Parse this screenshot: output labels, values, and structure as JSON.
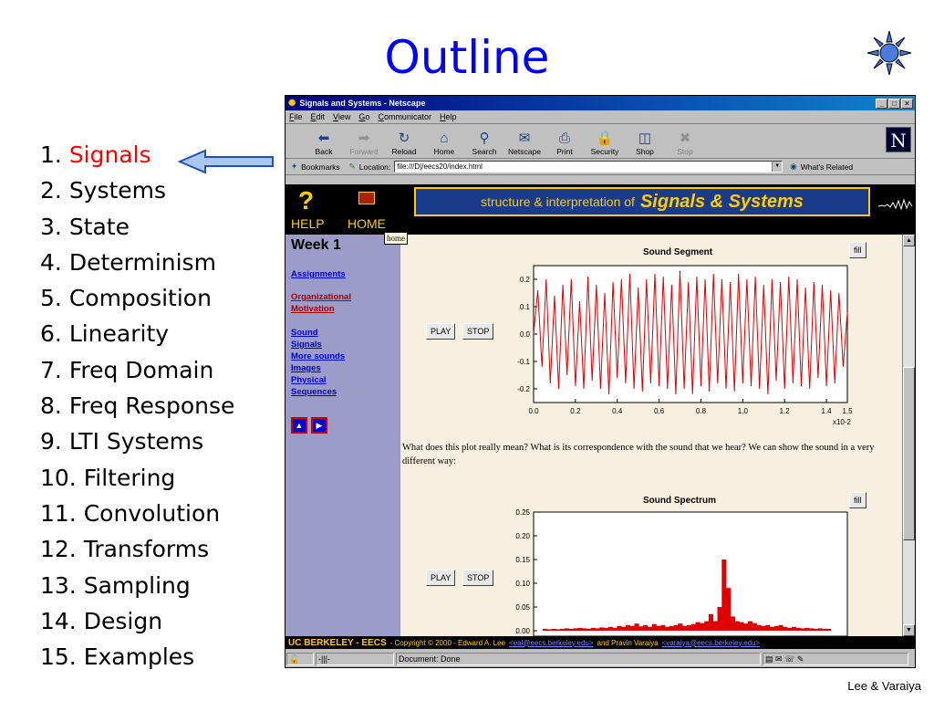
{
  "slide": {
    "title": "Outline",
    "credit": "Lee & Varaiya",
    "outline": [
      {
        "num": "1.",
        "label": "Signals",
        "active": true
      },
      {
        "num": "2.",
        "label": "Systems"
      },
      {
        "num": "3.",
        "label": "State"
      },
      {
        "num": "4.",
        "label": "Determinism"
      },
      {
        "num": "5.",
        "label": "Composition"
      },
      {
        "num": "6.",
        "label": "Linearity"
      },
      {
        "num": "7.",
        "label": "Freq Domain"
      },
      {
        "num": "8.",
        "label": "Freq Response"
      },
      {
        "num": "9.",
        "label": "LTI Systems"
      },
      {
        "num": "10.",
        "label": "Filtering"
      },
      {
        "num": "11.",
        "label": "Convolution"
      },
      {
        "num": "12.",
        "label": "Transforms"
      },
      {
        "num": "13.",
        "label": "Sampling"
      },
      {
        "num": "14.",
        "label": "Design"
      },
      {
        "num": "15.",
        "label": "Examples"
      }
    ]
  },
  "browser": {
    "window_title": "Signals and Systems - Netscape",
    "menu": [
      "File",
      "Edit",
      "View",
      "Go",
      "Communicator",
      "Help"
    ],
    "toolbar": [
      {
        "label": "Back",
        "icon": "back-icon",
        "glyph": "⬅"
      },
      {
        "label": "Forward",
        "icon": "forward-icon",
        "glyph": "➡",
        "disabled": true
      },
      {
        "label": "Reload",
        "icon": "reload-icon",
        "glyph": "↻"
      },
      {
        "label": "Home",
        "icon": "home-icon",
        "glyph": "⌂"
      },
      {
        "label": "Search",
        "icon": "search-icon",
        "glyph": "⚲"
      },
      {
        "label": "Netscape",
        "icon": "netscape-icon",
        "glyph": "✉"
      },
      {
        "label": "Print",
        "icon": "print-icon",
        "glyph": "⎙"
      },
      {
        "label": "Security",
        "icon": "security-icon",
        "glyph": "🔒"
      },
      {
        "label": "Shop",
        "icon": "shop-icon",
        "glyph": "◫"
      },
      {
        "label": "Stop",
        "icon": "stop-icon",
        "glyph": "✖",
        "disabled": true
      }
    ],
    "logo": "N",
    "bookmarks_label": "Bookmarks",
    "location_label": "Location:",
    "location_value": "file:///D|/eecs20/index.html",
    "whats_related": "What's Related",
    "status_text": "Document: Done"
  },
  "page": {
    "help_label": "HELP",
    "home_label": "HOME",
    "home_tooltip": "home",
    "banner_small": "structure & interpretation of",
    "banner_big": "Signals & Systems",
    "week": "Week 1",
    "nav_links": [
      {
        "text": "Assignments",
        "color": "blue"
      },
      {
        "text": "Organizational Motivation",
        "color": "red"
      },
      {
        "text": "Sound",
        "color": "blue"
      },
      {
        "text": "Signals",
        "color": "blue"
      },
      {
        "text": "More sounds",
        "color": "blue"
      },
      {
        "text": "Images",
        "color": "blue"
      },
      {
        "text": "Physical",
        "color": "blue"
      },
      {
        "text": "Sequences",
        "color": "blue"
      }
    ],
    "play_label": "PLAY",
    "stop_label": "STOP",
    "fill_label": "fill",
    "paragraph": "What does this plot really mean? What is its correspondence with the sound that we hear? We can show the sound in a very different way:",
    "footer": {
      "org": "UC BERKELEY - EECS",
      "copyright": "- Copyright © 2000 - Edward A. Lee",
      "email1": "<eal@eecs.berkeley.edu>",
      "and": "and Pravin Varaiya",
      "email2": "<varaiya@eecs.berkeley.edu>"
    }
  },
  "chart_data": [
    {
      "type": "line",
      "title": "Sound Segment",
      "x_ticks": [
        "0.0",
        "0.2",
        "0.4",
        "0.6",
        "0.8",
        "1.0",
        "1.2",
        "1.4",
        "1.5"
      ],
      "x_multiplier": "x10-2",
      "y_ticks": [
        "0.2",
        "0.1",
        "0.0",
        "-0.1",
        "-0.2"
      ],
      "xlim": [
        0,
        1.5
      ],
      "ylim": [
        -0.25,
        0.25
      ],
      "series": [
        {
          "color": "#e00000",
          "x": [
            0,
            0.02,
            0.04,
            0.06,
            0.08,
            0.1,
            0.12,
            0.14,
            0.16,
            0.18,
            0.2,
            0.22,
            0.24,
            0.26,
            0.28,
            0.3,
            0.32,
            0.34,
            0.36,
            0.38,
            0.4,
            0.42,
            0.44,
            0.46,
            0.48,
            0.5,
            0.52,
            0.54,
            0.56,
            0.58,
            0.6,
            0.62,
            0.64,
            0.66,
            0.68,
            0.7,
            0.72,
            0.74,
            0.76,
            0.78,
            0.8,
            0.82,
            0.84,
            0.86,
            0.88,
            0.9,
            0.92,
            0.94,
            0.96,
            0.98,
            1.0,
            1.02,
            1.04,
            1.06,
            1.08,
            1.1,
            1.12,
            1.14,
            1.16,
            1.18,
            1.2,
            1.22,
            1.24,
            1.26,
            1.28,
            1.3,
            1.32,
            1.34,
            1.36,
            1.38,
            1.4,
            1.42,
            1.44,
            1.46,
            1.48,
            1.5
          ],
          "y": [
            0.0,
            0.16,
            -0.12,
            0.2,
            -0.18,
            0.14,
            -0.2,
            0.18,
            -0.15,
            0.2,
            -0.19,
            0.12,
            -0.2,
            0.21,
            -0.17,
            0.18,
            -0.2,
            0.15,
            -0.22,
            0.19,
            -0.16,
            0.2,
            -0.18,
            0.22,
            -0.2,
            0.17,
            -0.21,
            0.2,
            -0.18,
            0.22,
            -0.19,
            0.21,
            -0.2,
            0.18,
            -0.22,
            0.23,
            -0.2,
            0.19,
            -0.22,
            0.21,
            -0.19,
            0.2,
            -0.21,
            0.22,
            -0.18,
            0.2,
            -0.2,
            0.19,
            -0.21,
            0.22,
            -0.18,
            0.2,
            -0.19,
            0.21,
            -0.2,
            0.18,
            -0.22,
            0.2,
            -0.17,
            0.19,
            -0.2,
            0.21,
            -0.18,
            0.2,
            -0.19,
            0.17,
            -0.2,
            0.19,
            -0.16,
            0.18,
            -0.19,
            0.16,
            -0.18,
            0.15,
            -0.12,
            0.08
          ]
        }
      ]
    },
    {
      "type": "bar",
      "title": "Sound Spectrum",
      "y_ticks": [
        "0.25",
        "0.20",
        "0.15",
        "0.10",
        "0.05",
        "0.00"
      ],
      "ylim": [
        0,
        0.25
      ],
      "series": [
        {
          "color": "#e00000",
          "values": [
            0.004,
            0.003,
            0.004,
            0.003,
            0.004,
            0.005,
            0.004,
            0.005,
            0.006,
            0.005,
            0.004,
            0.006,
            0.005,
            0.007,
            0.006,
            0.008,
            0.006,
            0.01,
            0.008,
            0.012,
            0.01,
            0.015,
            0.009,
            0.012,
            0.008,
            0.014,
            0.01,
            0.012,
            0.008,
            0.01,
            0.012,
            0.015,
            0.01,
            0.012,
            0.014,
            0.018,
            0.016,
            0.02,
            0.035,
            0.02,
            0.05,
            0.15,
            0.09,
            0.03,
            0.02,
            0.018,
            0.015,
            0.02,
            0.016,
            0.012,
            0.01,
            0.012,
            0.008,
            0.01,
            0.012,
            0.008,
            0.006,
            0.008,
            0.006,
            0.005,
            0.006,
            0.005,
            0.004,
            0.005,
            0.004,
            0.004
          ]
        }
      ]
    }
  ]
}
